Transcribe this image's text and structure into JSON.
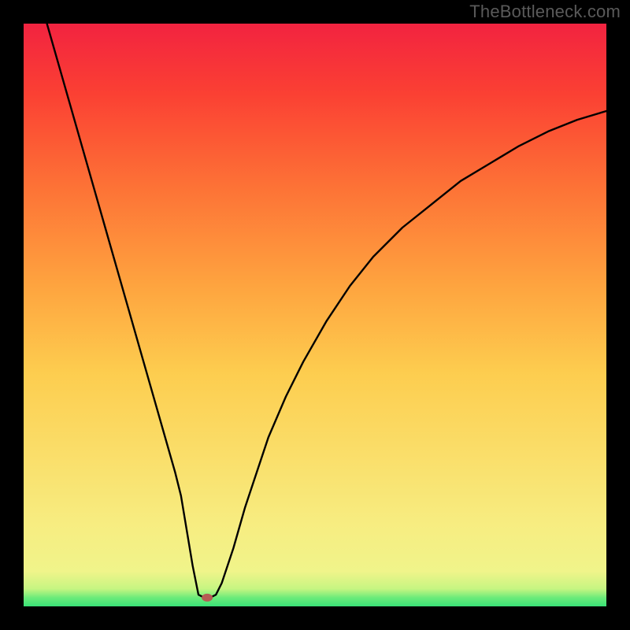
{
  "watermark": "TheBottleneck.com",
  "chart_data": {
    "type": "line",
    "title": "",
    "xlabel": "",
    "ylabel": "",
    "xlim": [
      0,
      100
    ],
    "ylim": [
      0,
      100
    ],
    "grid": false,
    "series": [
      {
        "name": "bottleneck-curve",
        "x": [
          4,
          6,
          8,
          10,
          12,
          14,
          16,
          18,
          20,
          22,
          24,
          26,
          27,
          28,
          29,
          30,
          31,
          32,
          33,
          34,
          36,
          38,
          40,
          42,
          45,
          48,
          52,
          56,
          60,
          65,
          70,
          75,
          80,
          85,
          90,
          95,
          100
        ],
        "values": [
          100,
          93,
          86,
          79,
          72,
          65,
          58,
          51,
          44,
          37,
          30,
          23,
          19,
          13,
          7,
          2,
          1.5,
          1.5,
          2,
          4,
          10,
          17,
          23,
          29,
          36,
          42,
          49,
          55,
          60,
          65,
          69,
          73,
          76,
          79,
          81.5,
          83.5,
          85
        ]
      }
    ],
    "marker": {
      "x": 31.5,
      "y": 1.5,
      "color": "#b65a54",
      "rx": 7,
      "ry": 5
    },
    "gradient_stops": [
      {
        "offset": 0.0,
        "color": "#39e277"
      },
      {
        "offset": 0.015,
        "color": "#6ceb7a"
      },
      {
        "offset": 0.03,
        "color": "#c6f582"
      },
      {
        "offset": 0.06,
        "color": "#f0f48a"
      },
      {
        "offset": 0.14,
        "color": "#f7ed81"
      },
      {
        "offset": 0.4,
        "color": "#fdcd4f"
      },
      {
        "offset": 0.55,
        "color": "#fea43f"
      },
      {
        "offset": 0.72,
        "color": "#fd7236"
      },
      {
        "offset": 0.88,
        "color": "#fb4033"
      },
      {
        "offset": 1.0,
        "color": "#f22340"
      }
    ]
  }
}
